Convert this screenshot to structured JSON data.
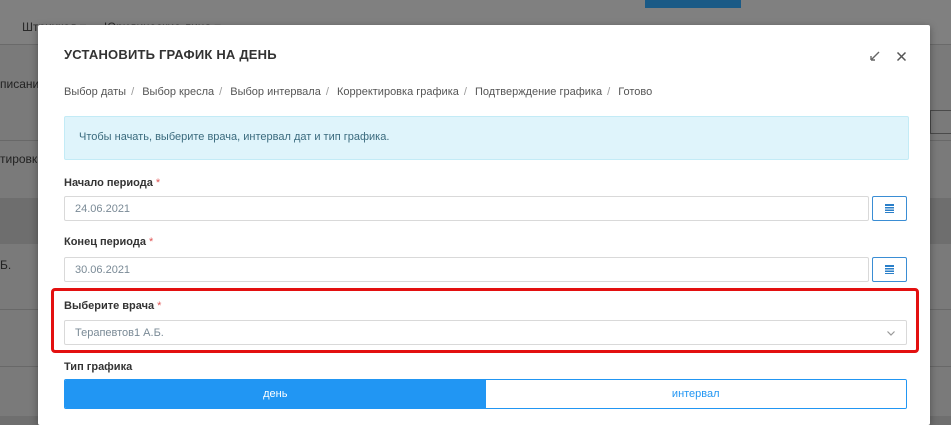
{
  "background": {
    "menu": [
      "Штрихкод ▾",
      "Юридические лица ▾"
    ],
    "left_fragments": [
      "писание",
      "тировка",
      "Б."
    ]
  },
  "modal": {
    "title": "УСТАНОВИТЬ ГРАФИК НА ДЕНЬ",
    "breadcrumb": [
      "Выбор даты",
      "Выбор кресла",
      "Выбор интервала",
      "Корректировка графика",
      "Подтверждение графика",
      "Готово"
    ],
    "alert": "Чтобы начать, выберите врача, интервал дат и тип графика.",
    "period_start": {
      "label": "Начало периода",
      "value": "24.06.2021"
    },
    "period_end": {
      "label": "Конец периода",
      "value": "30.06.2021"
    },
    "doctor": {
      "label": "Выберите врача",
      "value": "Терапевтов1 А.Б."
    },
    "schedule_type": {
      "label": "Тип графика",
      "options": [
        "день",
        "интервал"
      ],
      "selected": "день"
    },
    "required_mark": "*"
  },
  "colors": {
    "primary": "#2196f3",
    "highlight": "#e31010",
    "alert_bg": "#dff4fb"
  }
}
